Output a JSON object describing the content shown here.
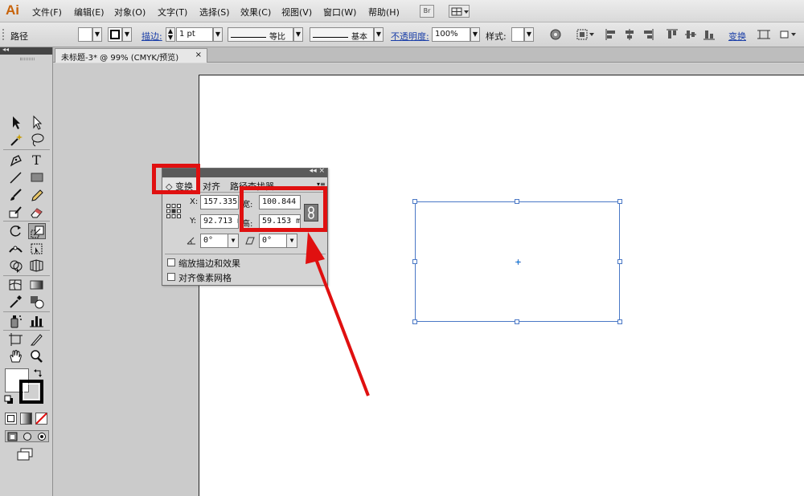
{
  "app": {
    "logo": "Ai"
  },
  "menu": {
    "items": [
      "文件(F)",
      "编辑(E)",
      "对象(O)",
      "文字(T)",
      "选择(S)",
      "效果(C)",
      "视图(V)",
      "窗口(W)",
      "帮助(H)"
    ],
    "bridge_label": "Br"
  },
  "control_bar": {
    "selection_type": "路径",
    "stroke_label": "描边:",
    "stroke_weight": "1 pt",
    "profile_label": "等比",
    "brush_label": "基本",
    "opacity_label": "不透明度:",
    "opacity_value": "100%",
    "style_label": "样式:",
    "transform_label": "变换"
  },
  "document": {
    "tab_title": "未标题-3* @ 99% (CMYK/预览)",
    "close_symbol": "×"
  },
  "transform_panel": {
    "tabs": [
      "◇ 变换",
      "对齐",
      "路径查找器"
    ],
    "x_label": "X:",
    "x_value": "157.335",
    "y_label": "Y:",
    "y_value": "92.713 m",
    "w_label": "宽:",
    "w_value": "100.844",
    "h_label": "高:",
    "h_value": "59.153 m",
    "rotate_value": "0°",
    "shear_value": "0°",
    "option_scale_strokes": "缩放描边和效果",
    "option_align_pixel_grid": "对齐像素网格",
    "header_controls": "◂◂ ×"
  },
  "colors": {
    "annotation_red": "#e01010",
    "selection_blue": "#4a78c6",
    "link_blue": "#1b3fa8",
    "logo_orange": "#c8630a"
  }
}
